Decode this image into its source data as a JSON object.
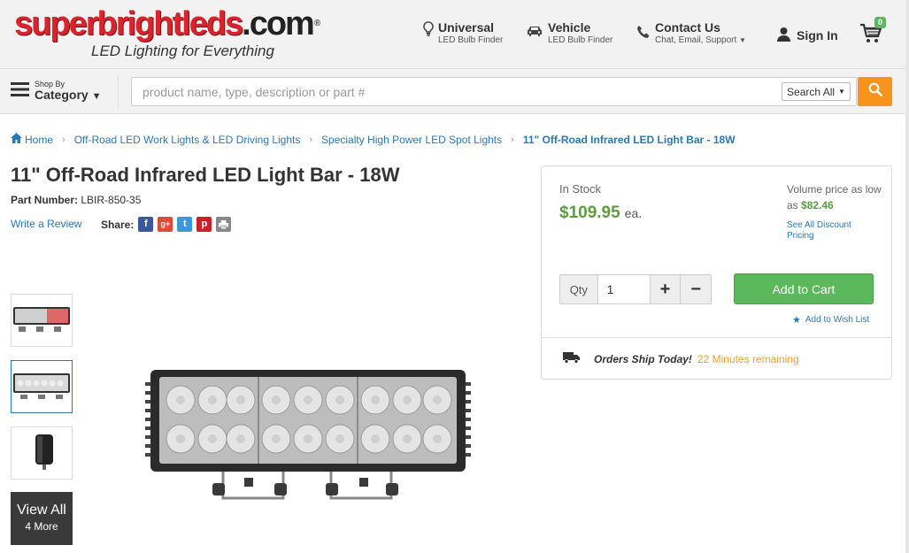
{
  "header": {
    "logo_red": "superbrightleds",
    "logo_dark": ".com",
    "logo_mark": "®",
    "tagline": "LED Lighting for Everything",
    "universal": {
      "title": "Universal",
      "sub": "LED Bulb Finder"
    },
    "vehicle": {
      "title": "Vehicle",
      "sub": "LED Bulb Finder"
    },
    "contact": {
      "title": "Contact Us",
      "sub": "Chat, Email, Support"
    },
    "signin": "Sign In",
    "cart_count": "0"
  },
  "search": {
    "shop_by": "Shop By",
    "category": "Category",
    "placeholder": "product name, type, description or part #",
    "scope": "Search All"
  },
  "breadcrumb": [
    "Home",
    "Off-Road LED Work Lights & LED Driving Lights",
    "Specialty High Power LED Spot Lights",
    "11\" Off-Road Infrared LED Light Bar - 18W"
  ],
  "product": {
    "title": "11\" Off-Road Infrared LED Light Bar - 18W",
    "part_label": "Part Number:",
    "part_number": "LBIR-850-35",
    "review": "Write a Review",
    "share": "Share:"
  },
  "thumbs": {
    "view_all": "View All",
    "more": "4 More"
  },
  "buybox": {
    "stock": "In Stock",
    "price": "$109.95",
    "unit": "ea.",
    "volume_text": "Volume price as low as",
    "volume_price": "$82.46",
    "discount_link": "See All Discount Pricing",
    "qty_label": "Qty",
    "qty_value": "1",
    "add_to_cart": "Add to Cart",
    "wishlist": "Add to Wish List",
    "ship_text": "Orders Ship Today!",
    "ship_remaining": "22 Minutes remaining"
  },
  "colors": {
    "brand_red": "#d9232d",
    "link_blue": "#2a78b6",
    "price_green": "#5a9e3e",
    "cart_green": "#5cb85c",
    "search_orange": "#f7941d"
  }
}
